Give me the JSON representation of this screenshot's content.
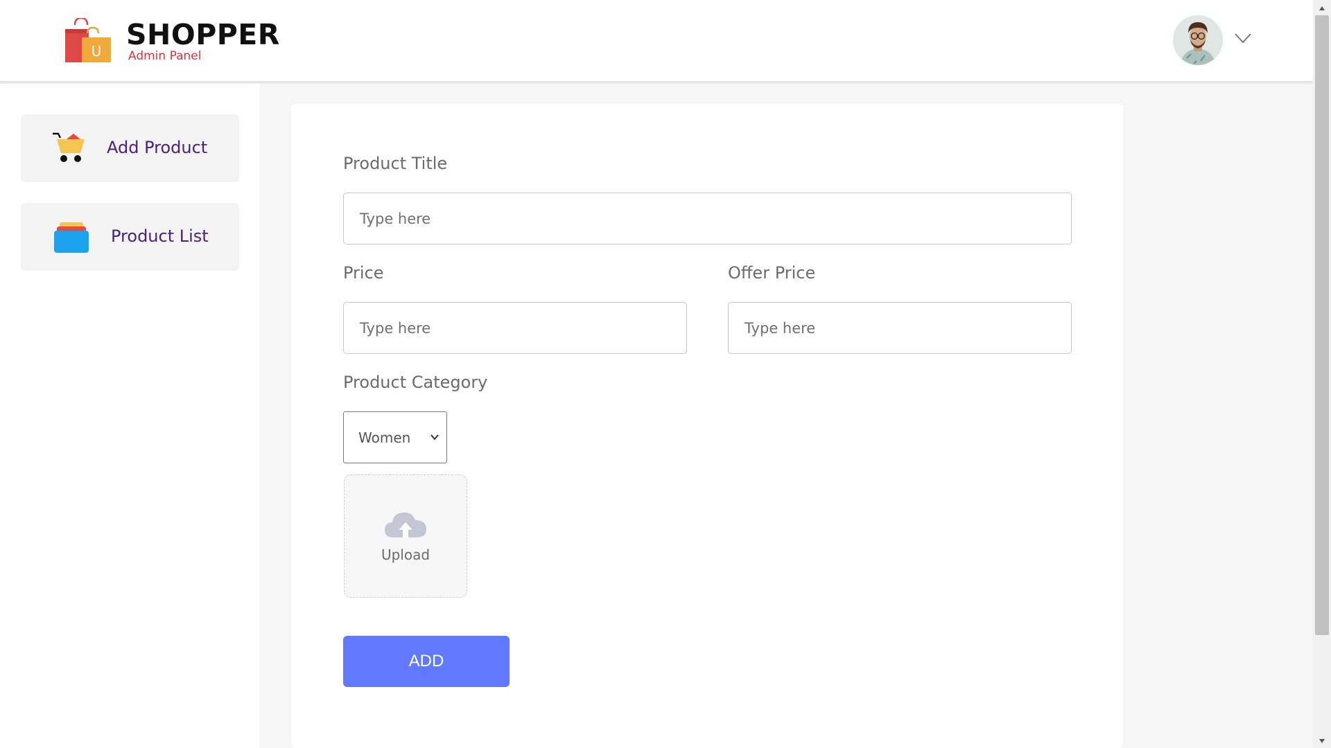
{
  "header": {
    "brand": "SHOPPER",
    "subtitle": "Admin Panel",
    "logo_icon": "shopping-bags-icon",
    "avatar_icon": "user-avatar",
    "menu_icon": "chevron-down-icon"
  },
  "sidebar": {
    "items": [
      {
        "label": "Add Product",
        "icon": "cart-icon"
      },
      {
        "label": "Product List",
        "icon": "stacked-cards-icon"
      }
    ]
  },
  "form": {
    "title_label": "Product Title",
    "title_placeholder": "Type here",
    "price_label": "Price",
    "price_placeholder": "Type here",
    "offer_price_label": "Offer Price",
    "offer_price_placeholder": "Type here",
    "category_label": "Product Category",
    "category_value": "Women",
    "upload_label": "Upload",
    "upload_icon": "cloud-upload-icon",
    "submit_label": "ADD"
  },
  "colors": {
    "brand_red": "#e0303a",
    "sidebar_text": "#4b1f7a",
    "button": "#6079ff"
  }
}
